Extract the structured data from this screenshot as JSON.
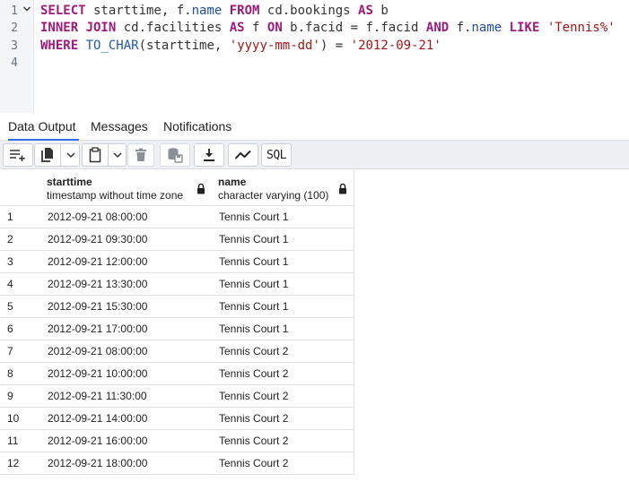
{
  "editor": {
    "line_numbers": [
      "1",
      "2",
      "3",
      "4"
    ],
    "lines": [
      [
        {
          "t": "SELECT",
          "c": "kw"
        },
        {
          "t": " starttime, f.",
          "c": "plain"
        },
        {
          "t": "name",
          "c": "ident"
        },
        {
          "t": " ",
          "c": "plain"
        },
        {
          "t": "FROM",
          "c": "kw"
        },
        {
          "t": " cd.bookings ",
          "c": "plain"
        },
        {
          "t": "AS",
          "c": "kw"
        },
        {
          "t": " b",
          "c": "plain"
        }
      ],
      [
        {
          "t": "INNER JOIN",
          "c": "kw"
        },
        {
          "t": " cd.facilities ",
          "c": "plain"
        },
        {
          "t": "AS",
          "c": "kw"
        },
        {
          "t": " f ",
          "c": "plain"
        },
        {
          "t": "ON",
          "c": "kw"
        },
        {
          "t": " b.facid = f.facid ",
          "c": "plain"
        },
        {
          "t": "AND",
          "c": "kw"
        },
        {
          "t": " f.",
          "c": "plain"
        },
        {
          "t": "name",
          "c": "ident"
        },
        {
          "t": " ",
          "c": "plain"
        },
        {
          "t": "LIKE",
          "c": "kw"
        },
        {
          "t": " ",
          "c": "plain"
        },
        {
          "t": "'Tennis%'",
          "c": "str"
        }
      ],
      [
        {
          "t": "WHERE",
          "c": "kw"
        },
        {
          "t": " ",
          "c": "plain"
        },
        {
          "t": "TO_CHAR",
          "c": "fn"
        },
        {
          "t": "(starttime, ",
          "c": "plain"
        },
        {
          "t": "'yyyy-mm-dd'",
          "c": "str"
        },
        {
          "t": ") = ",
          "c": "plain"
        },
        {
          "t": "'2012-09-21'",
          "c": "str"
        }
      ],
      []
    ]
  },
  "tabs": [
    {
      "label": "Data Output",
      "active": true
    },
    {
      "label": "Messages",
      "active": false
    },
    {
      "label": "Notifications",
      "active": false
    }
  ],
  "toolbar": {
    "sql_label": "SQL",
    "icons": [
      "add-row-icon",
      "copy-icon",
      "chevron-down-icon",
      "paste-icon",
      "chevron-down-icon",
      "delete-icon",
      "save-data-icon",
      "download-icon",
      "graph-icon"
    ]
  },
  "grid": {
    "columns": [
      {
        "name": "starttime",
        "type": "timestamp without time zone"
      },
      {
        "name": "name",
        "type": "character varying (100)"
      }
    ],
    "rows": [
      [
        "1",
        "2012-09-21 08:00:00",
        "Tennis Court 1"
      ],
      [
        "2",
        "2012-09-21 09:30:00",
        "Tennis Court 1"
      ],
      [
        "3",
        "2012-09-21 12:00:00",
        "Tennis Court 1"
      ],
      [
        "4",
        "2012-09-21 13:30:00",
        "Tennis Court 1"
      ],
      [
        "5",
        "2012-09-21 15:30:00",
        "Tennis Court 1"
      ],
      [
        "6",
        "2012-09-21 17:00:00",
        "Tennis Court 1"
      ],
      [
        "7",
        "2012-09-21 08:00:00",
        "Tennis Court 2"
      ],
      [
        "8",
        "2012-09-21 10:00:00",
        "Tennis Court 2"
      ],
      [
        "9",
        "2012-09-21 11:30:00",
        "Tennis Court 2"
      ],
      [
        "10",
        "2012-09-21 14:00:00",
        "Tennis Court 2"
      ],
      [
        "11",
        "2012-09-21 16:00:00",
        "Tennis Court 2"
      ],
      [
        "12",
        "2012-09-21 18:00:00",
        "Tennis Court 2"
      ]
    ]
  },
  "colors": {
    "keyword": "#9b1c7a",
    "function": "#1f58b0",
    "string": "#a31515",
    "active_tab": "#326ce5"
  }
}
